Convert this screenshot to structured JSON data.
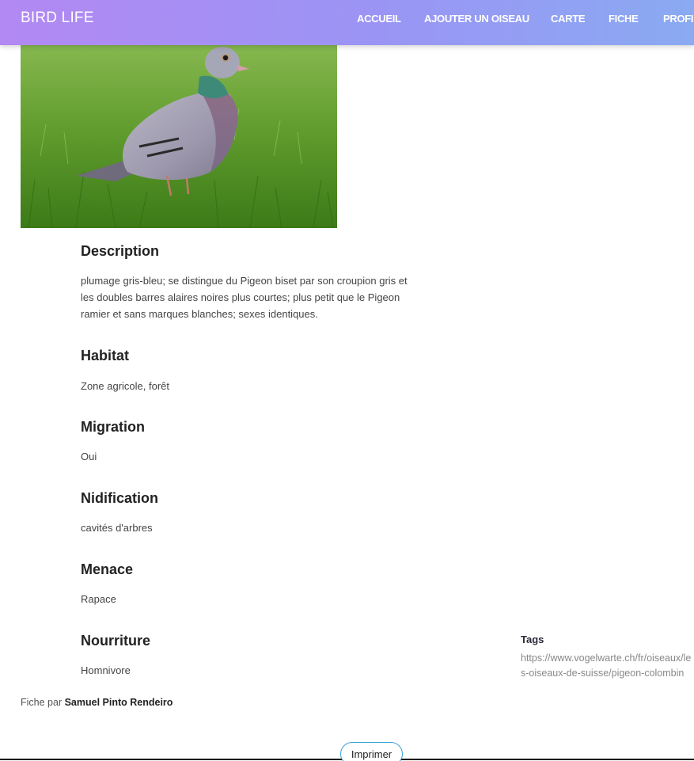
{
  "nav": {
    "brand": "BIRD LIFE",
    "links": [
      "ACCUEIL",
      "AJOUTER UN OISEAU",
      "CARTE",
      "FICHE",
      "PROFIL"
    ]
  },
  "colors": {
    "nav_gradient_start": "#b388f3",
    "nav_gradient_end": "#8aaaf2",
    "button_border": "#3aa0d8"
  },
  "sections": [
    {
      "title": "Description",
      "text": "plumage gris-bleu; se distingue du Pigeon biset par son croupion gris et les doubles barres alaires noires plus courtes; plus petit que le Pigeon ramier et sans marques blanches; sexes identiques."
    },
    {
      "title": "Habitat",
      "text": "Zone agricole, forêt"
    },
    {
      "title": "Migration",
      "text": "Oui"
    },
    {
      "title": "Nidification",
      "text": "cavités d'arbres"
    },
    {
      "title": "Menace",
      "text": "Rapace"
    },
    {
      "title": "Nourriture",
      "text": "Homnivore"
    }
  ],
  "tags": {
    "title": "Tags",
    "link": "https://www.vogelwarte.ch/fr/oiseaux/les-oiseaux-de-suisse/pigeon-colombin"
  },
  "author": {
    "prefix": "Fiche par",
    "name": "Samuel Pinto Rendeiro"
  },
  "print_label": "Imprimer"
}
